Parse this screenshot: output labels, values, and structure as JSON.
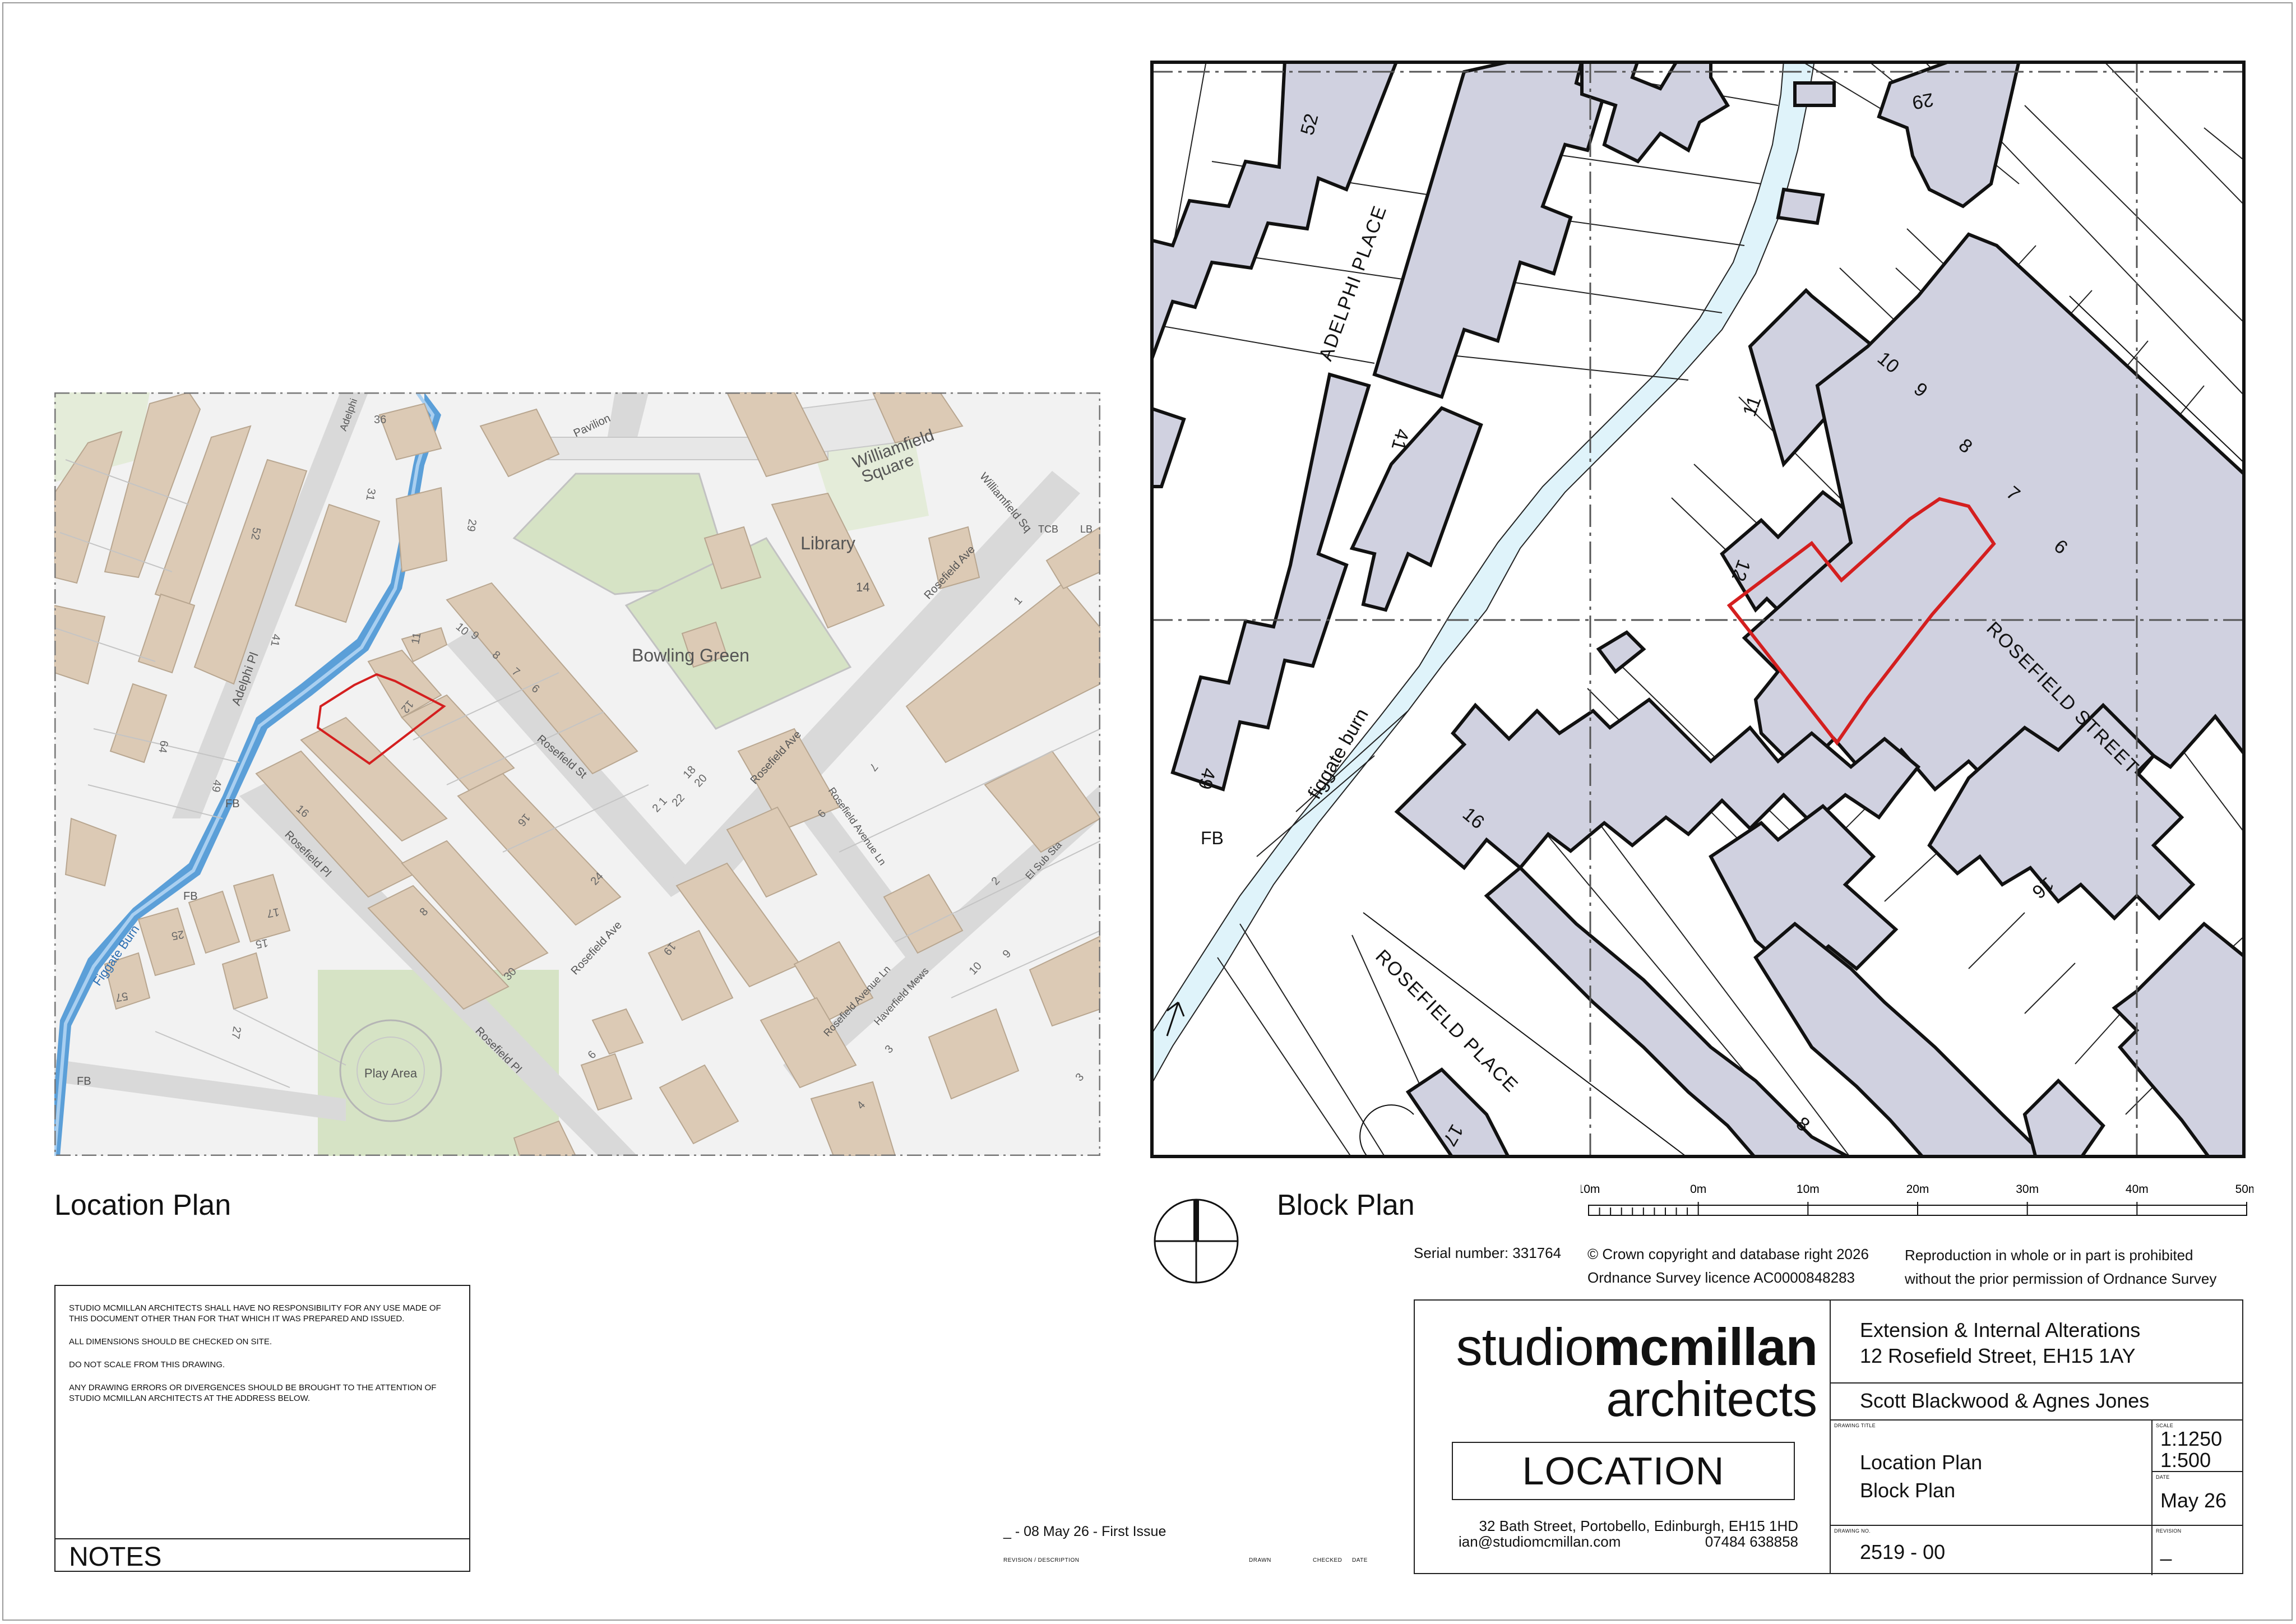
{
  "location_plan": {
    "title": "Location Plan",
    "map_labels": {
      "bowling_green": "Bowling Green",
      "library": "Library",
      "library_no": "14",
      "williamfield_square": "Williamfield",
      "williamfield_square2": "Square",
      "williamfield_sq": "Williamfield Sq",
      "play_area": "Play Area",
      "figgate_burn": "Figgate Burn",
      "adelphi_pl": "Adelphi Pl",
      "rosefield_st": "Rosefield St",
      "rosefield_ave": "Rosefield Ave",
      "rosefield_ave2": "Rosefield Ave",
      "rosefield_ave3": "Rosefield Ave",
      "rosefield_pl": "Rosefield Pl",
      "rosefield_pl2": "Rosefield Pl",
      "rosefield_avenue_ln": "Rosefield Avenue Ln",
      "rosefield_avenue_ln2": "Rosefield Avenue Ln",
      "haverfield_mews": "Haverfield Mews",
      "el_sub_sta": "El Sub Sta",
      "tcb": "TCB",
      "lb": "LB",
      "fb1": "FB",
      "fb2": "FB",
      "fb3": "FB",
      "pavilion": "Pavilion",
      "adelphi_top": "Adelphi",
      "n36": "36",
      "n31": "31",
      "n29": "29",
      "n52": "52",
      "n41": "41",
      "n64": "64",
      "n49": "49",
      "n11": "11",
      "n12": "12",
      "n10": "10",
      "n9": "9",
      "n8": "8",
      "n7": "7",
      "n6": "6",
      "n16a": "16",
      "n16b": "16",
      "n24": "24",
      "n8b": "8",
      "n30": "30",
      "n18": "18",
      "n20": "20",
      "n1_22": "22",
      "n2_21": "2 1",
      "n17": "17",
      "n15": "15",
      "n25": "25",
      "n57": "57",
      "n27": "27",
      "n19": "19",
      "n1": "1",
      "n7b": "7",
      "n2": "2",
      "n6b": "6",
      "n9b": "9",
      "n10b": "10",
      "n3": "3",
      "n4": "4",
      "n3b": "3",
      "n6c": "6"
    }
  },
  "block_plan": {
    "title": "Block Plan",
    "labels": {
      "adelphi_place": "ADELPHI PLACE",
      "rosefield_street": "ROSEFIELD STREET",
      "rosefield_place": "ROSEFIELD PLACE",
      "figgate_burn": "figgate burn",
      "fb": "FB",
      "n52": "52",
      "n41": "41",
      "n49": "49",
      "n29": "29",
      "n11": "11",
      "n12": "12",
      "n10": "10",
      "n9": "9",
      "n8": "8",
      "n7": "7",
      "n6": "6",
      "n16": "16",
      "n16b": "16",
      "n8b": "8",
      "n17": "17"
    },
    "scale_bar": {
      "labels": [
        "10m",
        "0m",
        "10m",
        "20m",
        "30m",
        "40m",
        "50m"
      ],
      "values": [
        -10,
        0,
        10,
        20,
        30,
        40,
        50
      ],
      "minor_divisions": 10
    }
  },
  "copyright": {
    "serial": "Serial number: 331764",
    "crown_line1": "© Crown copyright and database right 2026",
    "crown_line2": "Ordnance Survey licence AC0000848283",
    "repro_line1": "Reproduction in whole or in part is prohibited",
    "repro_line2": "without the prior permission of Ordnance Survey"
  },
  "notes": {
    "title": "NOTES",
    "lines": [
      "STUDIO MCMILLAN ARCHITECTS SHALL HAVE NO RESPONSIBILITY FOR ANY USE MADE OF THIS DOCUMENT OTHER THAN FOR THAT WHICH IT WAS PREPARED AND ISSUED.",
      "ALL DIMENSIONS SHOULD BE CHECKED ON SITE.",
      "DO NOT SCALE FROM THIS DRAWING.",
      "ANY DRAWING ERRORS OR DIVERGENCES SHOULD BE BROUGHT TO THE ATTENTION OF STUDIO MCMILLAN ARCHITECTS AT THE ADDRESS BELOW."
    ]
  },
  "revisions": {
    "entry": "_ - 08 May 26 - First Issue",
    "head_desc": "REVISION / DESCRIPTION",
    "head_drawn": "DRAWN",
    "head_checked": "CHECKED",
    "head_date": "DATE"
  },
  "title_block": {
    "brand_light": "studio",
    "brand_bold": "mcmillan",
    "brand_line2": "architects",
    "sheet_label": "LOCATION",
    "address": "32 Bath Street, Portobello, Edinburgh, EH15 1HD",
    "email": "ian@studiomcmillan.com",
    "phone": "07484 638858",
    "project_line1": "Extension & Internal Alterations",
    "project_line2": "12 Rosefield Street, EH15 1AY",
    "client": "Scott Blackwood & Agnes Jones",
    "drawing_title_label": "DRAWING TITLE",
    "drawing_title_1": "Location Plan",
    "drawing_title_2": "Block Plan",
    "scale_label": "SCALE",
    "scale_1": "1:1250",
    "scale_2": "1:500",
    "date_label": "DATE",
    "date": "May 26",
    "drawing_no_label": "DRAWING No.",
    "drawing_no": "2519 - 00",
    "revision_label": "REVISION",
    "revision": "_"
  },
  "colors": {
    "building_block": "#d0d1e0",
    "building_map": "#dccab5",
    "water": "#dff3fa",
    "water_map": "#5b9fd8",
    "site_outline": "#d41f1f",
    "road_map": "#d9d9d9",
    "green_map": "#d6e3c5"
  }
}
